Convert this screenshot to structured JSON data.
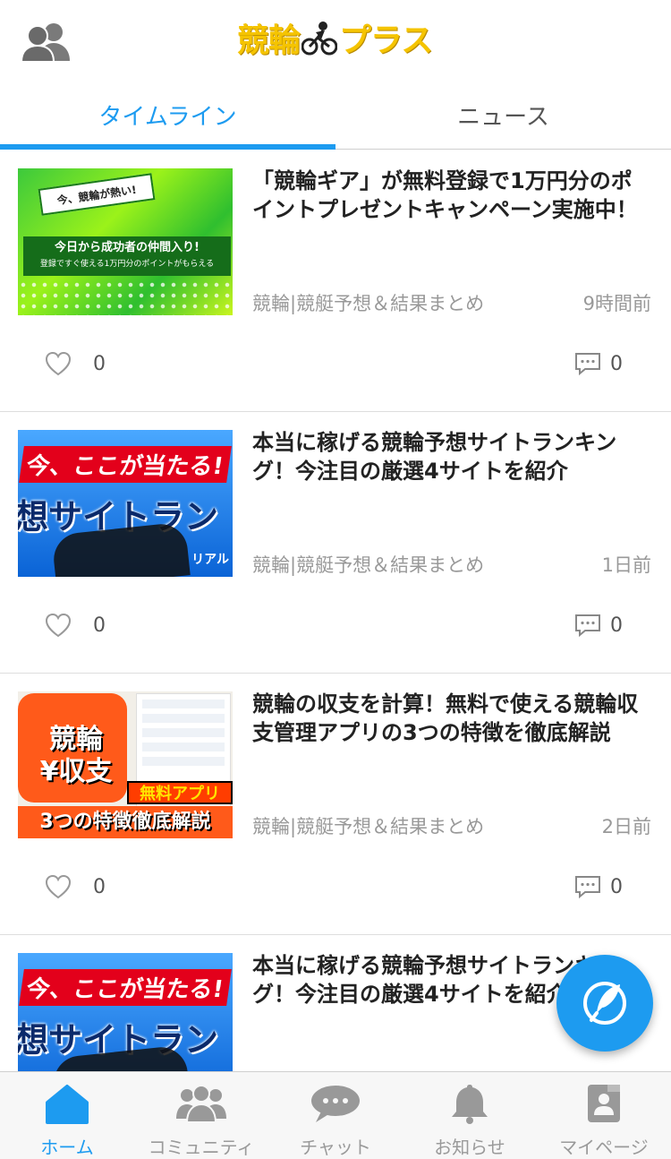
{
  "header": {
    "logo_text_a": "競輪",
    "logo_text_b": "プラス"
  },
  "tabs": [
    {
      "label": "タイムライン",
      "active": true
    },
    {
      "label": "ニュース",
      "active": false
    }
  ],
  "feed": [
    {
      "title": "「競輪ギア」が無料登録で1万円分のポイントプレゼントキャンペーン実施中！",
      "source": "競輪|競艇予想＆結果まとめ",
      "time": "9時間前",
      "likes": "0",
      "comments": "0",
      "thumb": {
        "banner_top": "今、競輪が熱い!",
        "banner_main": "今日から成功者の仲間入り!",
        "banner_sub": "登録ですぐ使える1万円分のポイントがもらえる"
      }
    },
    {
      "title": "本当に稼げる競輪予想サイトランキング！今注目の厳選4サイトを紹介",
      "source": "競輪|競艇予想＆結果まとめ",
      "time": "1日前",
      "likes": "0",
      "comments": "0",
      "thumb": {
        "line1": "今、ここが当たる!",
        "line2": "想サイトラン",
        "brand": "リアル"
      }
    },
    {
      "title": "競輪の収支を計算！無料で使える競輪収支管理アプリの3つの特徴を徹底解説",
      "source": "競輪|競艇予想＆結果まとめ",
      "time": "2日前",
      "likes": "0",
      "comments": "0",
      "thumb": {
        "app_line1": "競輪",
        "app_line2": "¥収支",
        "free": "無料アプリ",
        "bottom": "3つの特徴徹底解説"
      }
    },
    {
      "title": "本当に稼げる競輪予想サイトランキング！今注目の厳選4サイトを紹介",
      "thumb": {
        "line1": "今、ここが当たる!",
        "line2": "想サイトラン"
      }
    }
  ],
  "bottom_nav": [
    {
      "label": "ホーム",
      "icon": "home-icon",
      "active": true
    },
    {
      "label": "コミュニティ",
      "icon": "community-icon",
      "active": false
    },
    {
      "label": "チャット",
      "icon": "chat-icon",
      "active": false
    },
    {
      "label": "お知らせ",
      "icon": "bell-icon",
      "active": false
    },
    {
      "label": "マイページ",
      "icon": "mypage-icon",
      "active": false
    }
  ],
  "colors": {
    "accent": "#1d9bf0",
    "logo": "#f5c400",
    "muted": "#999999"
  }
}
